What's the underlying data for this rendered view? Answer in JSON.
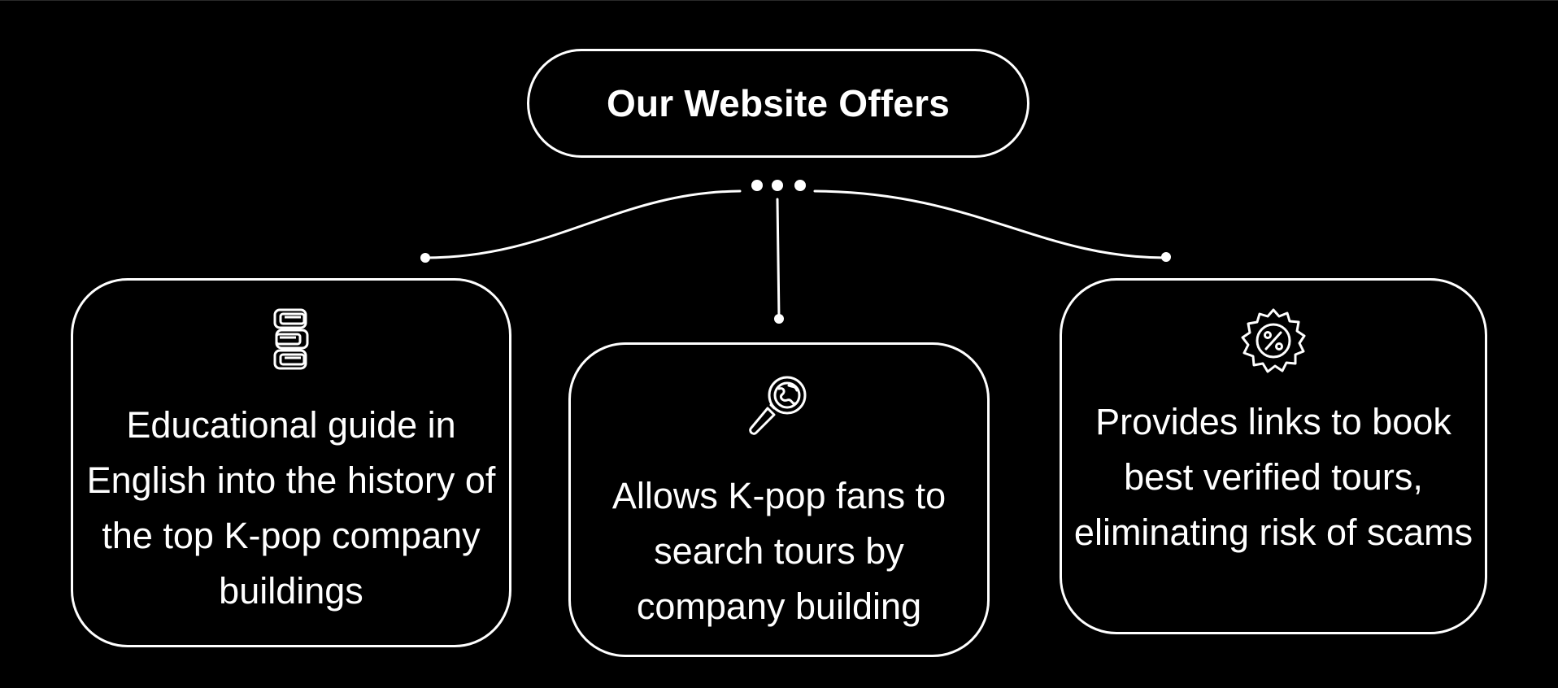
{
  "title": "Our Website Offers",
  "colors": {
    "background": "#000000",
    "foreground": "#ffffff"
  },
  "cards": [
    {
      "icon": "books-icon",
      "text": "Educational guide in English into the history of the top K-pop company buildings"
    },
    {
      "icon": "globe-magnifier-icon",
      "text": "Allows K-pop fans to search tours by company building"
    },
    {
      "icon": "discount-badge-icon",
      "text": "Provides links to book best verified tours, eliminating risk of scams"
    }
  ]
}
